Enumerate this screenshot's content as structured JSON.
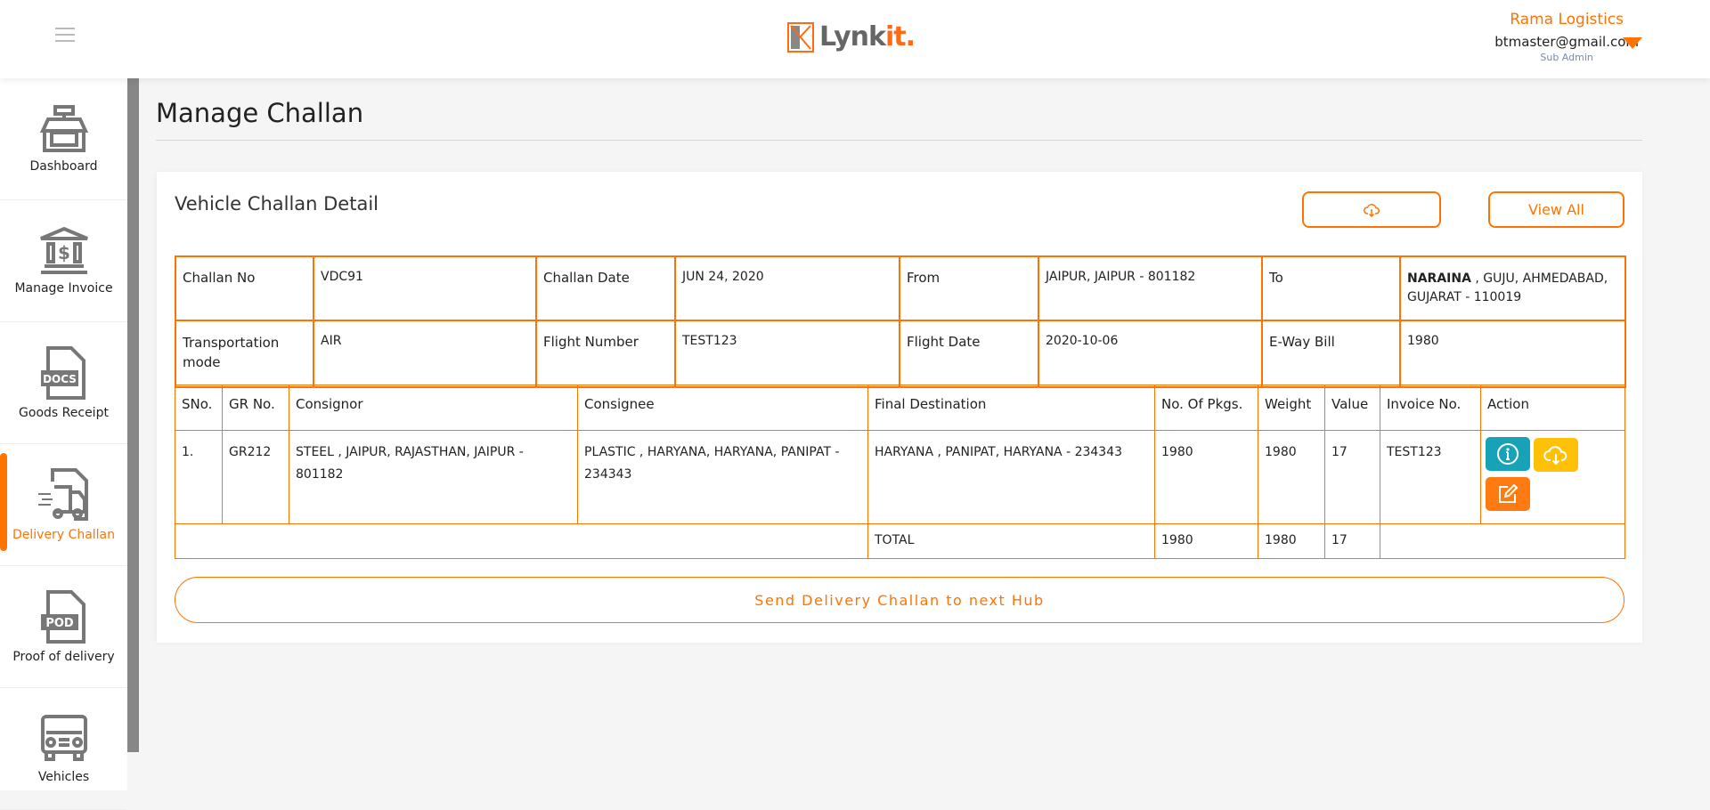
{
  "header": {
    "brand": "Lynk",
    "brand_accent": "it.",
    "company": "Rama Logistics",
    "email": "btmaster@gmail.com",
    "role": "Sub Admin"
  },
  "sidebar": {
    "items": [
      {
        "label": "Dashboard"
      },
      {
        "label": "Manage Invoice"
      },
      {
        "label": "Goods Receipt",
        "icon_text": "DOCS"
      },
      {
        "label": "Delivery Challan",
        "active": true
      },
      {
        "label": "Proof of delivery",
        "icon_text": "POD"
      },
      {
        "label": "Vehicles"
      }
    ]
  },
  "page": {
    "title": "Manage Challan"
  },
  "card": {
    "title": "Vehicle Challan Detail",
    "view_all": "View All",
    "send_label": "Send Delivery Challan to next Hub"
  },
  "details": [
    [
      {
        "k": "Challan No",
        "v": "VDC91"
      },
      {
        "k": "Challan Date",
        "v": "JUN 24, 2020"
      },
      {
        "k": "From",
        "v": "JAIPUR, JAIPUR - 801182"
      },
      {
        "k": "To",
        "v_bold": "NARAINA",
        "v": " , GUJU, AHMEDABAD, GUJARAT - 110019"
      }
    ],
    [
      {
        "k": "Transportation mode",
        "v": "AIR"
      },
      {
        "k": "Flight Number",
        "v": "TEST123"
      },
      {
        "k": "Flight Date",
        "v": "2020-10-06"
      },
      {
        "k": "E-Way Bill",
        "v": "1980"
      }
    ]
  ],
  "items": {
    "headers": [
      "SNo.",
      "GR No.",
      "Consignor",
      "Consignee",
      "Final Destination",
      "No. Of Pkgs.",
      "Weight",
      "Value",
      "Invoice No.",
      "Action"
    ],
    "rows": [
      [
        "1.",
        "GR212",
        "STEEL , JAIPUR, RAJASTHAN, JAIPUR - 801182",
        "PLASTIC , HARYANA, HARYANA, PANIPAT - 234343",
        "HARYANA , PANIPAT, HARYANA - 234343",
        "1980",
        "1980",
        "17",
        "TEST123"
      ]
    ],
    "total": {
      "label": "TOTAL",
      "pkgs": "1980",
      "weight": "1980",
      "value": "17"
    }
  },
  "colors": {
    "accent": "#ff7300",
    "info": "#17a2b8",
    "download": "#ffc107",
    "edit": "#ff7a10"
  }
}
